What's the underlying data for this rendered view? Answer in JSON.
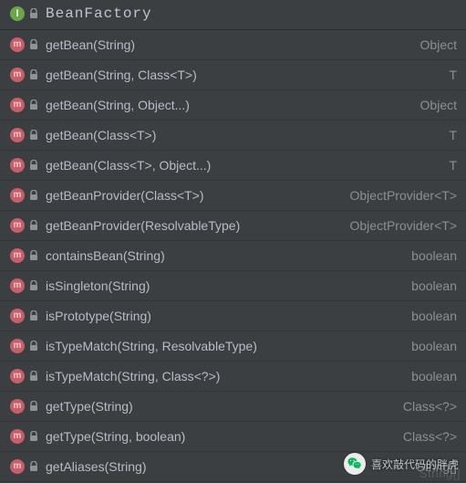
{
  "header": {
    "title": "BeanFactory"
  },
  "methods": [
    {
      "name": "getBean(String)",
      "ret": "Object"
    },
    {
      "name": "getBean(String, Class<T>)",
      "ret": "T"
    },
    {
      "name": "getBean(String, Object...)",
      "ret": "Object"
    },
    {
      "name": "getBean(Class<T>)",
      "ret": "T"
    },
    {
      "name": "getBean(Class<T>, Object...)",
      "ret": "T"
    },
    {
      "name": "getBeanProvider(Class<T>)",
      "ret": "ObjectProvider<T>"
    },
    {
      "name": "getBeanProvider(ResolvableType)",
      "ret": "ObjectProvider<T>"
    },
    {
      "name": "containsBean(String)",
      "ret": "boolean"
    },
    {
      "name": "isSingleton(String)",
      "ret": "boolean"
    },
    {
      "name": "isPrototype(String)",
      "ret": "boolean"
    },
    {
      "name": "isTypeMatch(String, ResolvableType)",
      "ret": "boolean"
    },
    {
      "name": "isTypeMatch(String, Class<?>)",
      "ret": "boolean"
    },
    {
      "name": "getType(String)",
      "ret": "Class<?>"
    },
    {
      "name": "getType(String, boolean)",
      "ret": "Class<?>"
    },
    {
      "name": "getAliases(String)",
      "ret": "String[]"
    }
  ],
  "watermark": {
    "text": "喜欢敲代码的胖虎"
  },
  "ghost": "String[]"
}
